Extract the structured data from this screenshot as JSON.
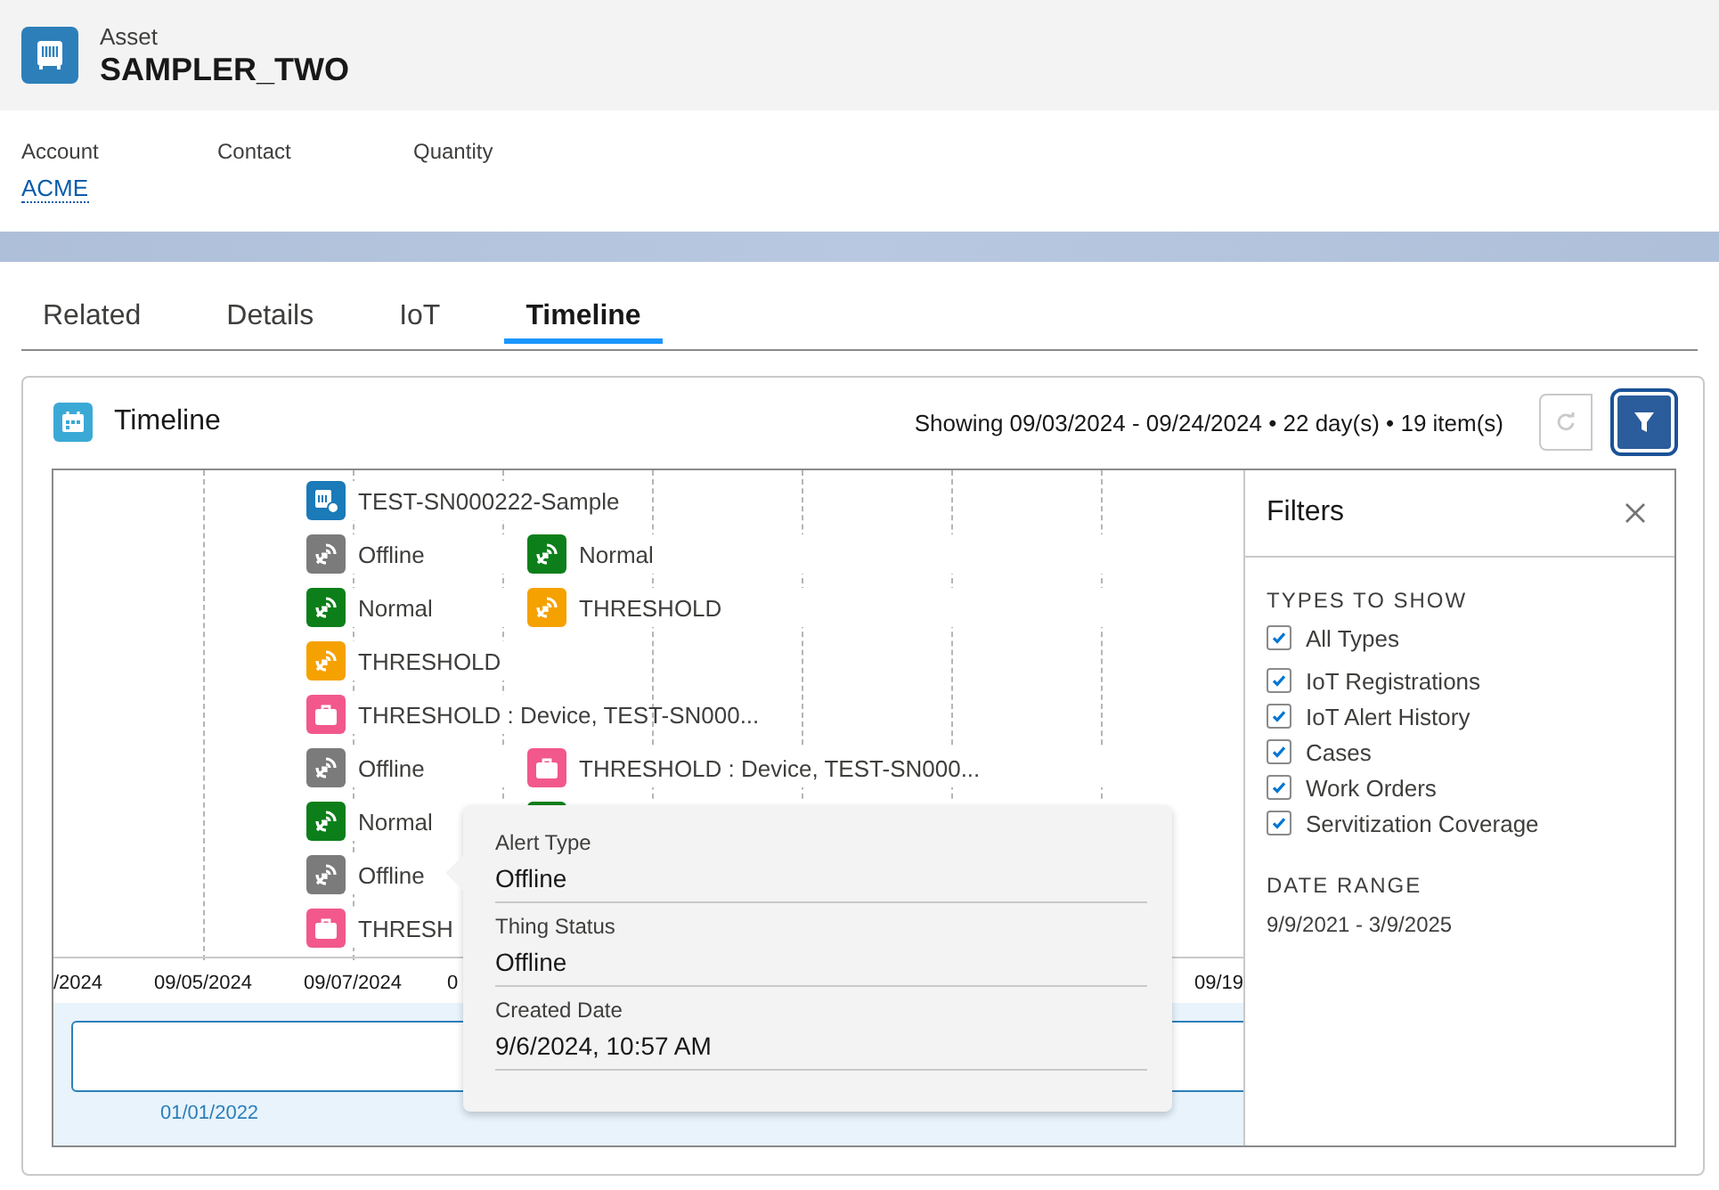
{
  "record": {
    "type_label": "Asset",
    "name": "SAMPLER_TWO"
  },
  "fields": [
    {
      "label": "Account",
      "value": "ACME",
      "kind": "link"
    },
    {
      "label": "Contact"
    },
    {
      "label": "Quantity"
    }
  ],
  "tabs": [
    {
      "label": "Related",
      "selected": false
    },
    {
      "label": "Details",
      "selected": false
    },
    {
      "label": "IoT",
      "selected": false
    },
    {
      "label": "Timeline",
      "selected": true
    }
  ],
  "timeline": {
    "title": "Timeline",
    "summary": "Showing 09/03/2024 - 09/24/2024 • 22 day(s) • 19 item(s)",
    "filter_active": true,
    "rows": [
      [
        {
          "kind": "registration",
          "color": "#1b7ab8",
          "label": "TEST-SN000222-Sample"
        }
      ],
      [
        {
          "kind": "alert",
          "color": "#7b7b7b",
          "label": "Offline"
        },
        {
          "kind": "alert",
          "color": "#0c7f1a",
          "label": "Normal"
        }
      ],
      [
        {
          "kind": "alert",
          "color": "#0c7f1a",
          "label": "Normal"
        },
        {
          "kind": "alert",
          "color": "#f5a100",
          "label": "THRESHOLD"
        }
      ],
      [
        {
          "kind": "alert",
          "color": "#f5a100",
          "label": "THRESHOLD"
        }
      ],
      [
        {
          "kind": "case",
          "color": "#f2588c",
          "label": "THRESHOLD : Device, TEST-SN000..."
        }
      ],
      [
        {
          "kind": "alert",
          "color": "#7b7b7b",
          "label": "Offline"
        },
        {
          "kind": "case",
          "color": "#f2588c",
          "label": "THRESHOLD : Device, TEST-SN000..."
        }
      ],
      [
        {
          "kind": "alert",
          "color": "#0c7f1a",
          "label": "Normal"
        },
        {
          "kind": "alert",
          "color": "#0c7f1a"
        }
      ],
      [
        {
          "kind": "alert",
          "color": "#7b7b7b",
          "label": "Offline"
        }
      ],
      [
        {
          "kind": "case",
          "color": "#f2588c",
          "label": "THRESH"
        }
      ]
    ],
    "axis_ticks": [
      "/2024",
      "09/05/2024",
      "09/07/2024",
      "0",
      "09/19"
    ],
    "overview_ticks": [
      "01/01/2022"
    ],
    "tooltip": [
      {
        "label": "Alert Type",
        "value": "Offline"
      },
      {
        "label": "Thing Status",
        "value": "Offline"
      },
      {
        "label": "Created Date",
        "value": "9/6/2024, 10:57 AM"
      }
    ],
    "filters": {
      "title": "Filters",
      "types_heading": "TYPES TO SHOW",
      "types": [
        {
          "label": "All Types",
          "checked": true
        },
        {
          "label": "IoT Registrations",
          "checked": true
        },
        {
          "label": "IoT Alert History",
          "checked": true
        },
        {
          "label": "Cases",
          "checked": true
        },
        {
          "label": "Work Orders",
          "checked": true
        },
        {
          "label": "Servitization Coverage",
          "checked": true
        }
      ],
      "date_heading": "DATE RANGE",
      "date_range": "9/9/2021 - 3/9/2025"
    }
  }
}
